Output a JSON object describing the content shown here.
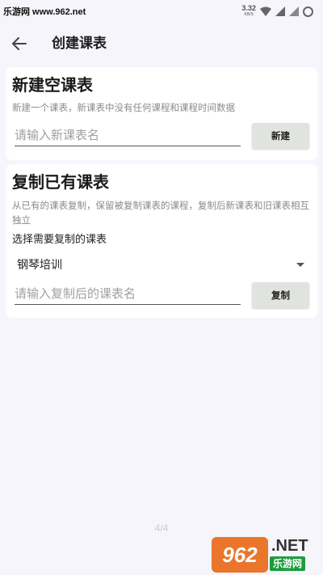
{
  "status_bar": {
    "watermark": "乐游网 www.962.net",
    "speed_value": "3.32",
    "speed_unit": "KB/S"
  },
  "app_bar": {
    "title": "创建课表",
    "back_icon": "arrow-left-icon"
  },
  "new_card": {
    "title": "新建空课表",
    "description": "新建一个课表，新课表中没有任何课程和课程时间数据",
    "name_placeholder": "请输入新课表名",
    "button_label": "新建"
  },
  "copy_card": {
    "title": "复制已有课表",
    "description": "从已有的课表复制，保留被复制课表的课程，复制后新课表和旧课表相互独立",
    "select_label": "选择需要复制的课表",
    "selected_value": "钢琴培训",
    "name_placeholder": "请输入复制后的课表名",
    "button_label": "复制"
  },
  "pager": "4/4",
  "logo": {
    "badge_text": "962",
    "net_text": ".NET",
    "cn_text": "乐游网"
  },
  "colors": {
    "background": "#f6f5fc",
    "card": "#ffffff",
    "button": "#e1e3df",
    "logo_orange": "#e9762b",
    "logo_green": "#1e9c3f"
  }
}
